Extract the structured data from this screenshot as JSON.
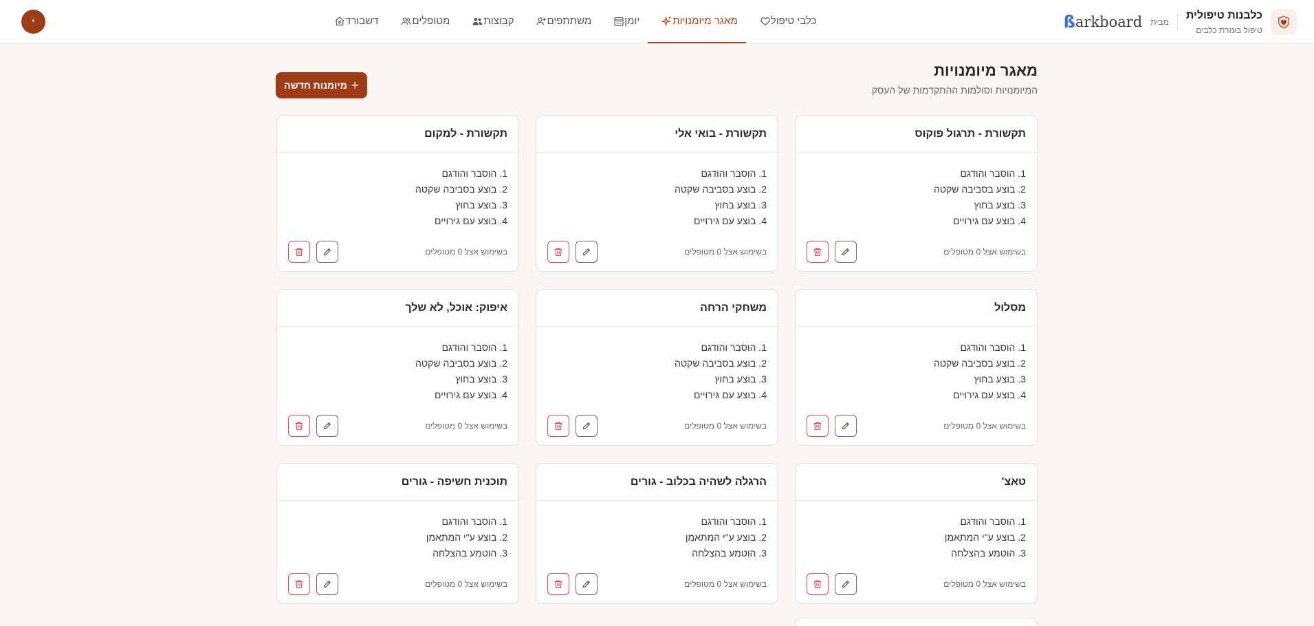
{
  "brand": {
    "name": "כלבנות טיפולית",
    "subtitle": "טיפול בעזרת כלבים",
    "presents": "מבית",
    "partner_logo": "Barkboard",
    "logo_icon": "heart-shield-icon"
  },
  "nav": {
    "items": [
      {
        "label": "דשבורד",
        "icon": "home-icon"
      },
      {
        "label": "מטופלים",
        "icon": "users-icon"
      },
      {
        "label": "קבוצות",
        "icon": "group-icon"
      },
      {
        "label": "משתתפים",
        "icon": "user-plus-icon"
      },
      {
        "label": "יומן",
        "icon": "calendar-icon"
      },
      {
        "label": "מאגר מיומנויות",
        "icon": "sparkles-icon",
        "active": true
      },
      {
        "label": "כלבי טיפול",
        "icon": "heart-icon"
      }
    ]
  },
  "user": {
    "avatar_initial": "י"
  },
  "page": {
    "title": "מאגר מיומנויות",
    "subtitle": "המיומנויות וסולמות ההתקדמות של העסק",
    "new_button": "מיומנות חדשה"
  },
  "colors": {
    "accent": "#9c3d18",
    "delete": "#e0485a"
  },
  "skills": [
    {
      "title": "תקשורת - תרגול פוקוס",
      "steps": [
        "1. הוסבר והודגם",
        "2. בוצע בסביבה שקטה",
        "3. בוצע בחוץ",
        "4. בוצע עם גירויים"
      ],
      "usage": "בשימוש אצל 0 מטופלים"
    },
    {
      "title": "תקשורת - בואי אלי",
      "steps": [
        "1. הוסבר והודגם",
        "2. בוצע בסביבה שקטה",
        "3. בוצע בחוץ",
        "4. בוצע עם גירויים"
      ],
      "usage": "בשימוש אצל 0 מטופלים"
    },
    {
      "title": "תקשורת - למקום",
      "steps": [
        "1. הוסבר והודגם",
        "2. בוצע בסביבה שקטה",
        "3. בוצע בחוץ",
        "4. בוצע עם גירויים"
      ],
      "usage": "בשימוש אצל 0 מטופלים"
    },
    {
      "title": "מסלול",
      "steps": [
        "1. הוסבר והודגם",
        "2. בוצע בסביבה שקטה",
        "3. בוצע בחוץ",
        "4. בוצע עם גירויים"
      ],
      "usage": "בשימוש אצל 0 מטופלים"
    },
    {
      "title": "משחקי הרחה",
      "steps": [
        "1. הוסבר והודגם",
        "2. בוצע בסביבה שקטה",
        "3. בוצע בחוץ",
        "4. בוצע עם גירויים"
      ],
      "usage": "בשימוש אצל 0 מטופלים"
    },
    {
      "title": "איפוק: אוכל, לא שלך",
      "steps": [
        "1. הוסבר והודגם",
        "2. בוצע בסביבה שקטה",
        "3. בוצע בחוץ",
        "4. בוצע עם גירויים"
      ],
      "usage": "בשימוש אצל 0 מטופלים"
    },
    {
      "title": "טאצ'",
      "steps": [
        "1. הוסבר והודגם",
        "2. בוצע ע\"י המתאמן",
        "3. הוטמע בהצלחה"
      ],
      "usage": "בשימוש אצל 0 מטופלים"
    },
    {
      "title": "הרגלה לשהיה בכלוב - גורים",
      "steps": [
        "1. הוסבר והודגם",
        "2. בוצע ע\"י המתאמן",
        "3. הוטמע בהצלחה"
      ],
      "usage": "בשימוש אצל 0 מטופלים"
    },
    {
      "title": "תוכנית חשיפה - גורים",
      "steps": [
        "1. הוסבר והודגם",
        "2. בוצע ע\"י המתאמן",
        "3. הוטמע בהצלחה"
      ],
      "usage": "בשימוש אצל 0 מטופלים"
    }
  ]
}
